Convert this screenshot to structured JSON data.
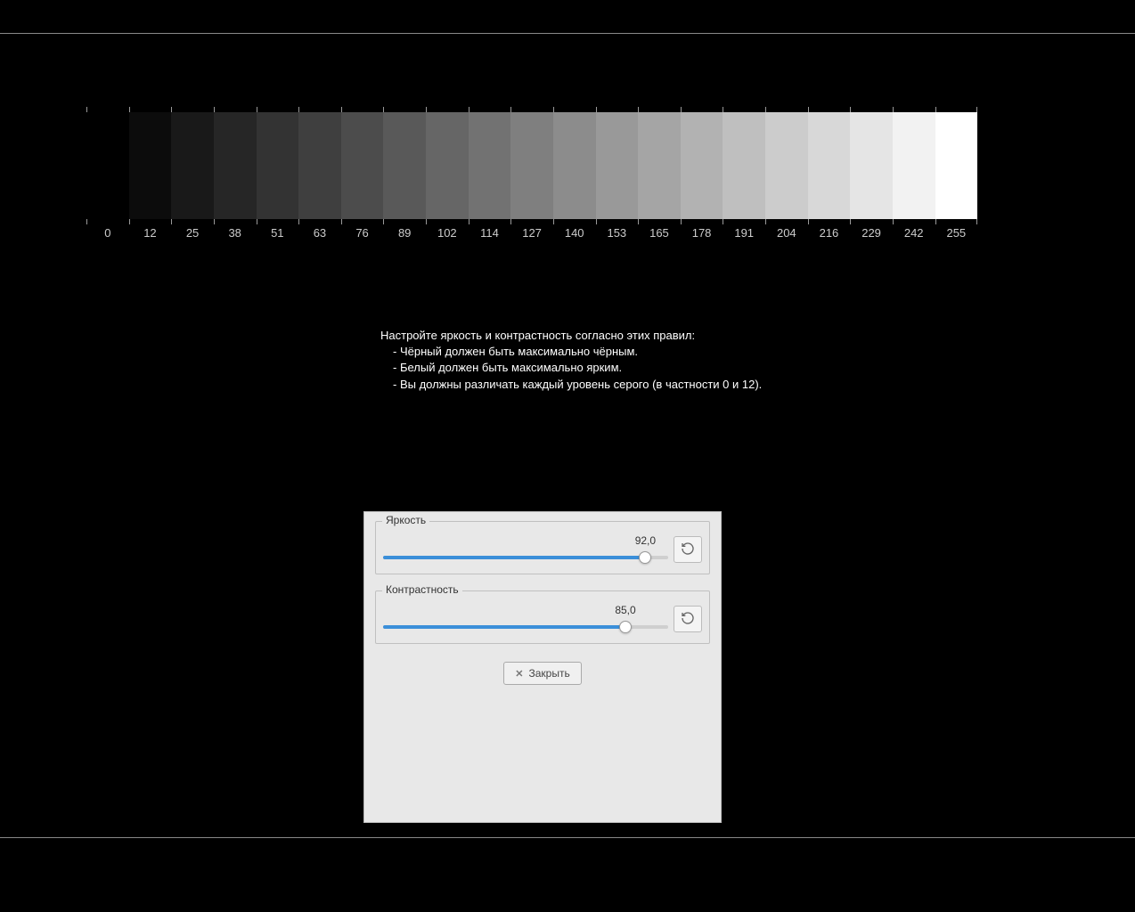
{
  "gradient": {
    "levels": [
      0,
      12,
      25,
      38,
      51,
      63,
      76,
      89,
      102,
      114,
      127,
      140,
      153,
      165,
      178,
      191,
      204,
      216,
      229,
      242,
      255
    ]
  },
  "instructions": {
    "title": "Настройте яркость и контрастность согласно этих правил:",
    "line1": "- Чёрный должен быть максимально чёрным.",
    "line2": "- Белый должен быть максимально ярким.",
    "line3": "- Вы должны различать каждый уровень серого (в частности 0 и 12)."
  },
  "dialog": {
    "brightness": {
      "label": "Яркость",
      "value": "92,0",
      "percent": 92
    },
    "contrast": {
      "label": "Контрастность",
      "value": "85,0",
      "percent": 85
    },
    "close_label": "Закрыть"
  }
}
